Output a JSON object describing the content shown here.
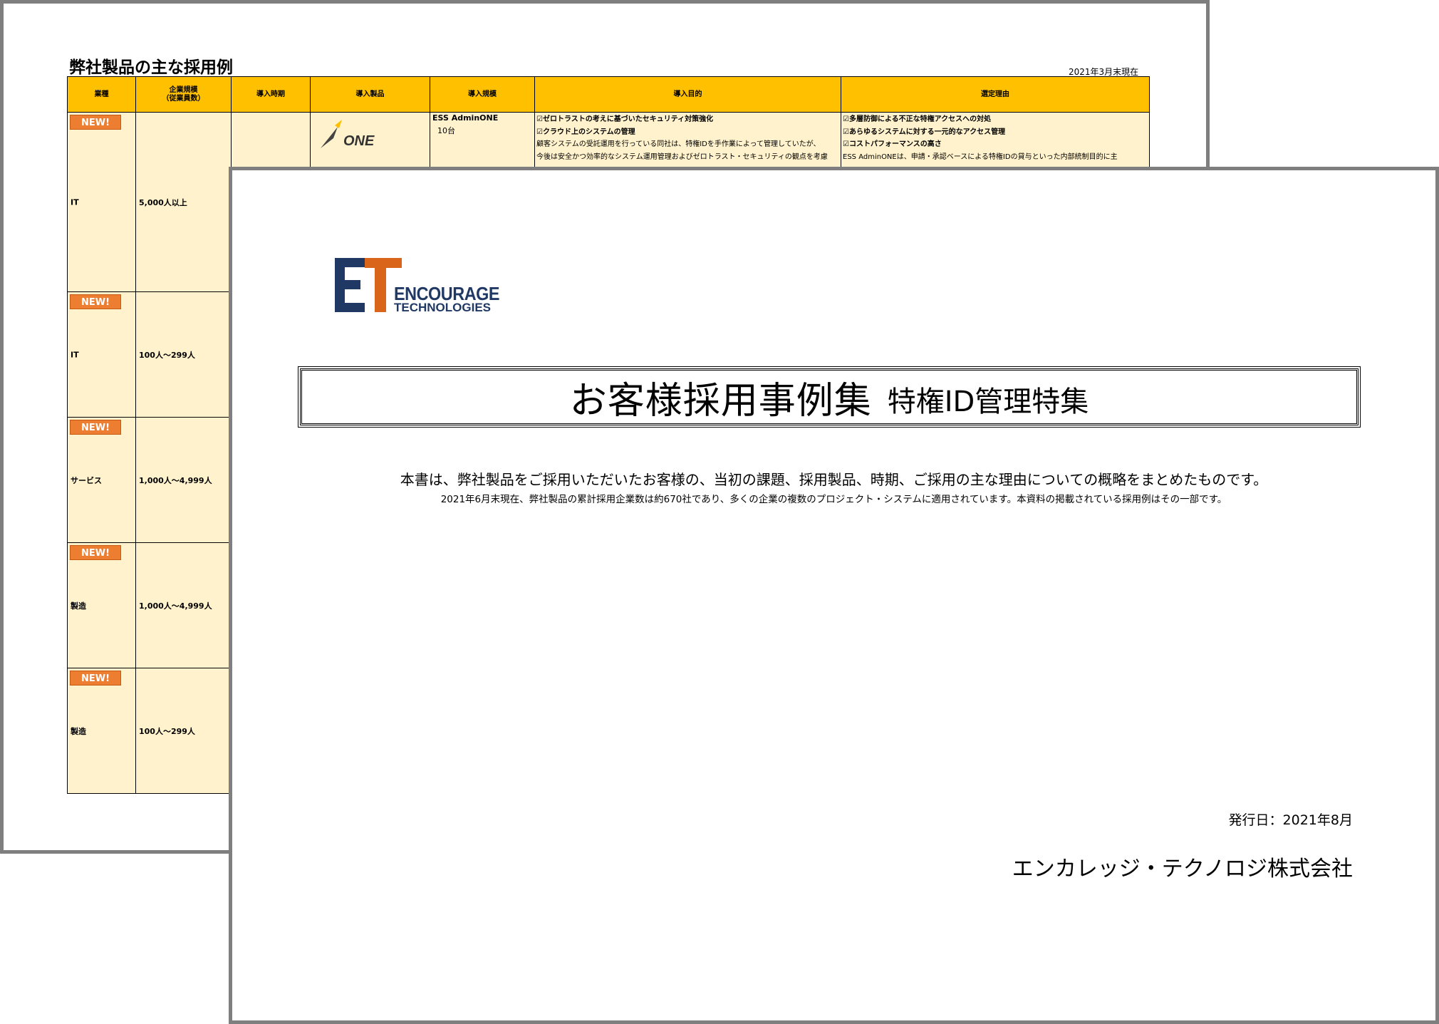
{
  "back_page": {
    "title": "弊社製品の主な採用例",
    "as_of": "2021年3月末現在",
    "columns": [
      "業種",
      "企業規模\n（従業員数）",
      "導入時期",
      "導入製品",
      "導入規模",
      "導入目的",
      "選定理由"
    ],
    "badge": "NEW!",
    "rows": [
      {
        "industry": "IT",
        "size": "5,000人以上"
      },
      {
        "industry": "IT",
        "size": "100人～299人"
      },
      {
        "industry": "サービス",
        "size": "1,000人～4,999人"
      },
      {
        "industry": "製造",
        "size": "1,000人～4,999人"
      },
      {
        "industry": "製造",
        "size": "100人～299人"
      }
    ],
    "first_row_detail": {
      "product_logo_text": "ONE",
      "product_name": "ESS AdminONE",
      "product_qty": "10台",
      "purpose_lines": [
        "☑ゼロトラストの考えに基づいたセキュリティ対策強化",
        "☑クラウド上のシステムの管理",
        "顧客システムの受託運用を行っている同社は、特権IDを手作業によって管理していたが、",
        "今後は安全かつ効率的なシステム運用管理およびゼロトラスト・セキュリティの観点を考慮"
      ],
      "reason_lines": [
        "☑多層防御による不正な特権アクセスへの対処",
        "☑あらゆるシステムに対する一元的なアクセス管理",
        "☑コストパフォーマンスの高さ",
        "ESS AdminONEは、申請・承認ベースによる特権IDの貸与といった内部統制目的に主"
      ]
    }
  },
  "front_page": {
    "logo": {
      "mark": "ET",
      "word1": "ENCOURAGE",
      "word2": "TECHNOLOGIES",
      "brand_navy": "#1f3864",
      "brand_orange": "#d9651b"
    },
    "title_main": "お客様採用事例集",
    "title_sub": "特権ID管理特集",
    "description_line1": "本書は、弊社製品をご採用いただいたお客様の、当初の課題、採用製品、時期、ご採用の主な理由についての概略をまとめたものです。",
    "description_line2": "2021年6月末現在、弊社製品の累計採用企業数は約670社であり、多くの企業の複数のプロジェクト・システムに適用されています。本資料の掲載されている採用例はその一部です。",
    "issue_date": "発行日：2021年8月",
    "company": "エンカレッジ・テクノロジ株式会社"
  },
  "colors": {
    "header_fill": "#ffc000",
    "cell_fill": "#fff2cc",
    "badge": "#ed7d31",
    "frame": "#7f7f7f"
  }
}
